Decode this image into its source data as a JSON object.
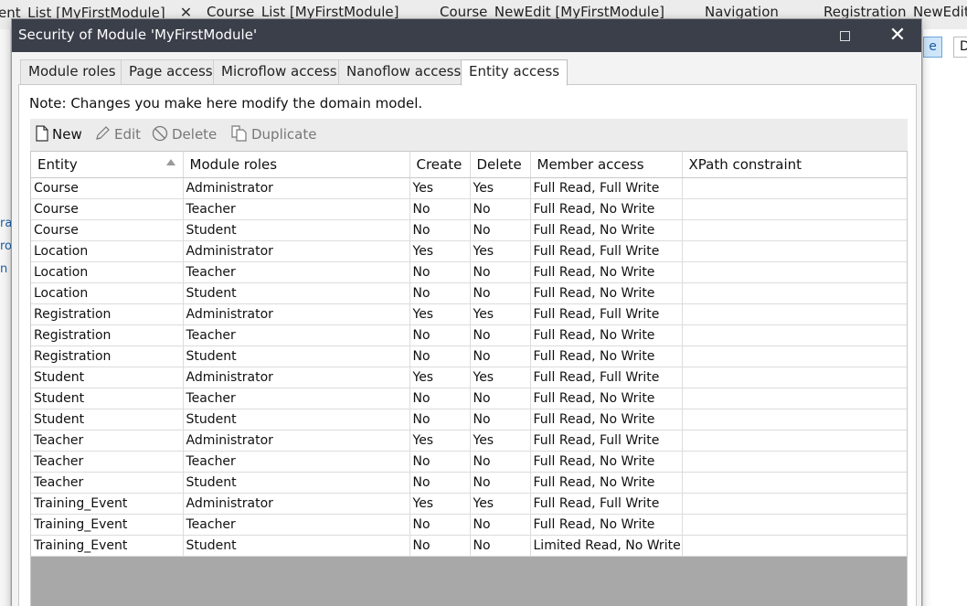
{
  "background": {
    "tabs": [
      {
        "label": "ent_List [MyFirstModule]",
        "closable": true
      },
      {
        "label": "Course_List [MyFirstModule]"
      },
      {
        "label": "Course_NewEdit [MyFirstModule]"
      },
      {
        "label": "Navigation"
      },
      {
        "label": "Registration_NewEdit"
      }
    ],
    "left_chars": [
      "ra",
      "ro",
      "n"
    ],
    "right_btn_blue": "e",
    "right_btn_white": "D"
  },
  "dialog": {
    "title": "Security of Module 'MyFirstModule'",
    "tabs": [
      "Module roles",
      "Page access",
      "Microflow access",
      "Nanoflow access",
      "Entity access"
    ],
    "active_tab": "Entity access",
    "note": "Note: Changes you make here modify the domain model.",
    "toolbar": {
      "new": "New",
      "edit": "Edit",
      "delete": "Delete",
      "duplicate": "Duplicate"
    },
    "table": {
      "columns": [
        "Entity",
        "Module roles",
        "Create",
        "Delete",
        "Member access",
        "XPath constraint"
      ],
      "sorted_column": "Entity",
      "rows": [
        [
          "Course",
          "Administrator",
          "Yes",
          "Yes",
          "Full Read, Full Write",
          ""
        ],
        [
          "Course",
          "Teacher",
          "No",
          "No",
          "Full Read, No Write",
          ""
        ],
        [
          "Course",
          "Student",
          "No",
          "No",
          "Full Read, No Write",
          ""
        ],
        [
          "Location",
          "Administrator",
          "Yes",
          "Yes",
          "Full Read, Full Write",
          ""
        ],
        [
          "Location",
          "Teacher",
          "No",
          "No",
          "Full Read, No Write",
          ""
        ],
        [
          "Location",
          "Student",
          "No",
          "No",
          "Full Read, No Write",
          ""
        ],
        [
          "Registration",
          "Administrator",
          "Yes",
          "Yes",
          "Full Read, Full Write",
          ""
        ],
        [
          "Registration",
          "Teacher",
          "No",
          "No",
          "Full Read, No Write",
          ""
        ],
        [
          "Registration",
          "Student",
          "No",
          "No",
          "Full Read, No Write",
          ""
        ],
        [
          "Student",
          "Administrator",
          "Yes",
          "Yes",
          "Full Read, Full Write",
          ""
        ],
        [
          "Student",
          "Teacher",
          "No",
          "No",
          "Full Read, No Write",
          ""
        ],
        [
          "Student",
          "Student",
          "No",
          "No",
          "Full Read, No Write",
          ""
        ],
        [
          "Teacher",
          "Administrator",
          "Yes",
          "Yes",
          "Full Read, Full Write",
          ""
        ],
        [
          "Teacher",
          "Teacher",
          "No",
          "No",
          "Full Read, No Write",
          ""
        ],
        [
          "Teacher",
          "Student",
          "No",
          "No",
          "Full Read, No Write",
          ""
        ],
        [
          "Training_Event",
          "Administrator",
          "Yes",
          "Yes",
          "Full Read, Full Write",
          ""
        ],
        [
          "Training_Event",
          "Teacher",
          "No",
          "No",
          "Full Read, No Write",
          ""
        ],
        [
          "Training_Event",
          "Student",
          "No",
          "No",
          "Limited Read, No Write",
          ""
        ]
      ]
    }
  },
  "colors": {
    "titlebar": "#3b3f4a",
    "grid_empty_area": "#a8a8a8",
    "accent_blue": "#1a5fa8"
  }
}
